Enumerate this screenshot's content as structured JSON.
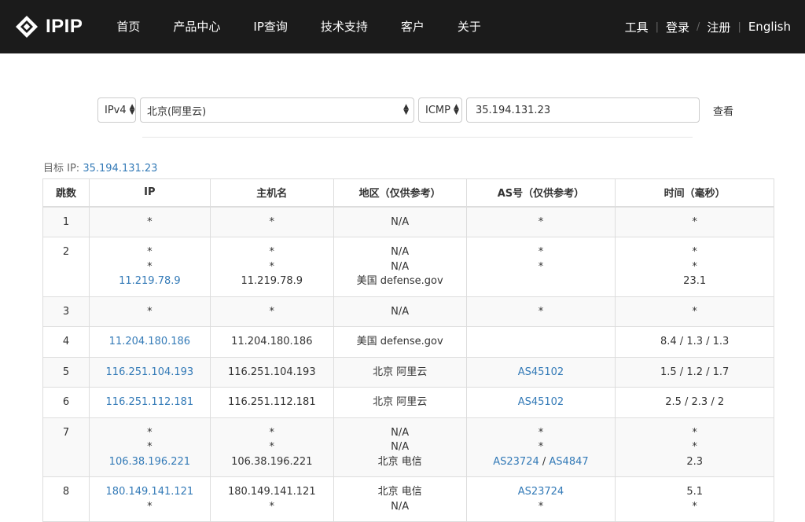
{
  "nav": {
    "logo_text": "IPIP",
    "items": [
      "首页",
      "产品中心",
      "IP查询",
      "技术支持",
      "客户",
      "关于"
    ],
    "right": [
      "工具",
      "登录",
      "注册",
      "English"
    ],
    "separators": [
      "|",
      "/",
      "|"
    ]
  },
  "query": {
    "ip_version": "IPv4",
    "node": "北京(阿里云)",
    "protocol": "ICMP",
    "target_input": "35.194.131.23",
    "submit_label": "查看"
  },
  "target": {
    "label": "目标 IP:",
    "ip": "35.194.131.23"
  },
  "table": {
    "headers": [
      "跳数",
      "IP",
      "主机名",
      "地区（仅供参考）",
      "AS号（仅供参考）",
      "时间（毫秒）"
    ],
    "rows": [
      {
        "hop": "1",
        "ip": [
          {
            "t": "*",
            "link": false
          }
        ],
        "host": [
          "*"
        ],
        "region": [
          "N/A"
        ],
        "as": [
          [
            {
              "t": "*",
              "link": false
            }
          ]
        ],
        "time": [
          "*"
        ]
      },
      {
        "hop": "2",
        "ip": [
          {
            "t": "*",
            "link": false
          },
          {
            "t": "*",
            "link": false
          },
          {
            "t": "11.219.78.9",
            "link": true
          }
        ],
        "host": [
          "*",
          "*",
          "11.219.78.9"
        ],
        "region": [
          "N/A",
          "N/A",
          "美国 defense.gov"
        ],
        "as": [
          [
            {
              "t": "*",
              "link": false
            }
          ],
          [
            {
              "t": "*",
              "link": false
            }
          ],
          []
        ],
        "time": [
          "*",
          "*",
          "23.1"
        ]
      },
      {
        "hop": "3",
        "ip": [
          {
            "t": "*",
            "link": false
          }
        ],
        "host": [
          "*"
        ],
        "region": [
          "N/A"
        ],
        "as": [
          [
            {
              "t": "*",
              "link": false
            }
          ]
        ],
        "time": [
          "*"
        ]
      },
      {
        "hop": "4",
        "ip": [
          {
            "t": "11.204.180.186",
            "link": true
          }
        ],
        "host": [
          "11.204.180.186"
        ],
        "region": [
          "美国 defense.gov"
        ],
        "as": [
          []
        ],
        "time": [
          "8.4 / 1.3 / 1.3"
        ]
      },
      {
        "hop": "5",
        "ip": [
          {
            "t": "116.251.104.193",
            "link": true
          }
        ],
        "host": [
          "116.251.104.193"
        ],
        "region": [
          "北京 阿里云"
        ],
        "as": [
          [
            {
              "t": "AS45102",
              "link": true
            }
          ]
        ],
        "time": [
          "1.5 / 1.2 / 1.7"
        ]
      },
      {
        "hop": "6",
        "ip": [
          {
            "t": "116.251.112.181",
            "link": true
          }
        ],
        "host": [
          "116.251.112.181"
        ],
        "region": [
          "北京 阿里云"
        ],
        "as": [
          [
            {
              "t": "AS45102",
              "link": true
            }
          ]
        ],
        "time": [
          "2.5 / 2.3 / 2"
        ]
      },
      {
        "hop": "7",
        "ip": [
          {
            "t": "*",
            "link": false
          },
          {
            "t": "*",
            "link": false
          },
          {
            "t": "106.38.196.221",
            "link": true
          }
        ],
        "host": [
          "*",
          "*",
          "106.38.196.221"
        ],
        "region": [
          "N/A",
          "N/A",
          "北京 电信"
        ],
        "as": [
          [
            {
              "t": "*",
              "link": false
            }
          ],
          [
            {
              "t": "*",
              "link": false
            }
          ],
          [
            {
              "t": "AS23724",
              "link": true
            },
            {
              "t": "/",
              "link": false
            },
            {
              "t": "AS4847",
              "link": true
            }
          ]
        ],
        "time": [
          "*",
          "*",
          "2.3"
        ]
      },
      {
        "hop": "8",
        "ip": [
          {
            "t": "180.149.141.121",
            "link": true
          },
          {
            "t": "*",
            "link": false
          }
        ],
        "host": [
          "180.149.141.121",
          "*"
        ],
        "region": [
          "北京 电信",
          "N/A"
        ],
        "as": [
          [
            {
              "t": "AS23724",
              "link": true
            }
          ],
          [
            {
              "t": "*",
              "link": false
            }
          ]
        ],
        "time": [
          "5.1",
          "*"
        ]
      }
    ]
  }
}
